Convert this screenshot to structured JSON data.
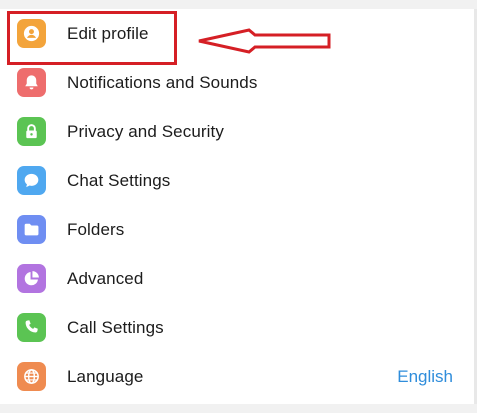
{
  "settings_menu": {
    "items": [
      {
        "label": "Edit profile",
        "icon": "person-icon",
        "color": "#f3a43b"
      },
      {
        "label": "Notifications and Sounds",
        "icon": "bell-icon",
        "color": "#ee6d6d"
      },
      {
        "label": "Privacy and Security",
        "icon": "lock-icon",
        "color": "#5bc453"
      },
      {
        "label": "Chat Settings",
        "icon": "chat-bubble-icon",
        "color": "#4fa8f0"
      },
      {
        "label": "Folders",
        "icon": "folder-icon",
        "color": "#6f8ef2"
      },
      {
        "label": "Advanced",
        "icon": "pie-chart-icon",
        "color": "#b274e0"
      },
      {
        "label": "Call Settings",
        "icon": "phone-icon",
        "color": "#5bc453"
      },
      {
        "label": "Language",
        "icon": "globe-icon",
        "color": "#ef8b50",
        "value": "English"
      }
    ]
  },
  "colors": {
    "accent": "#2f8ddb",
    "annotation": "#d51f25"
  }
}
